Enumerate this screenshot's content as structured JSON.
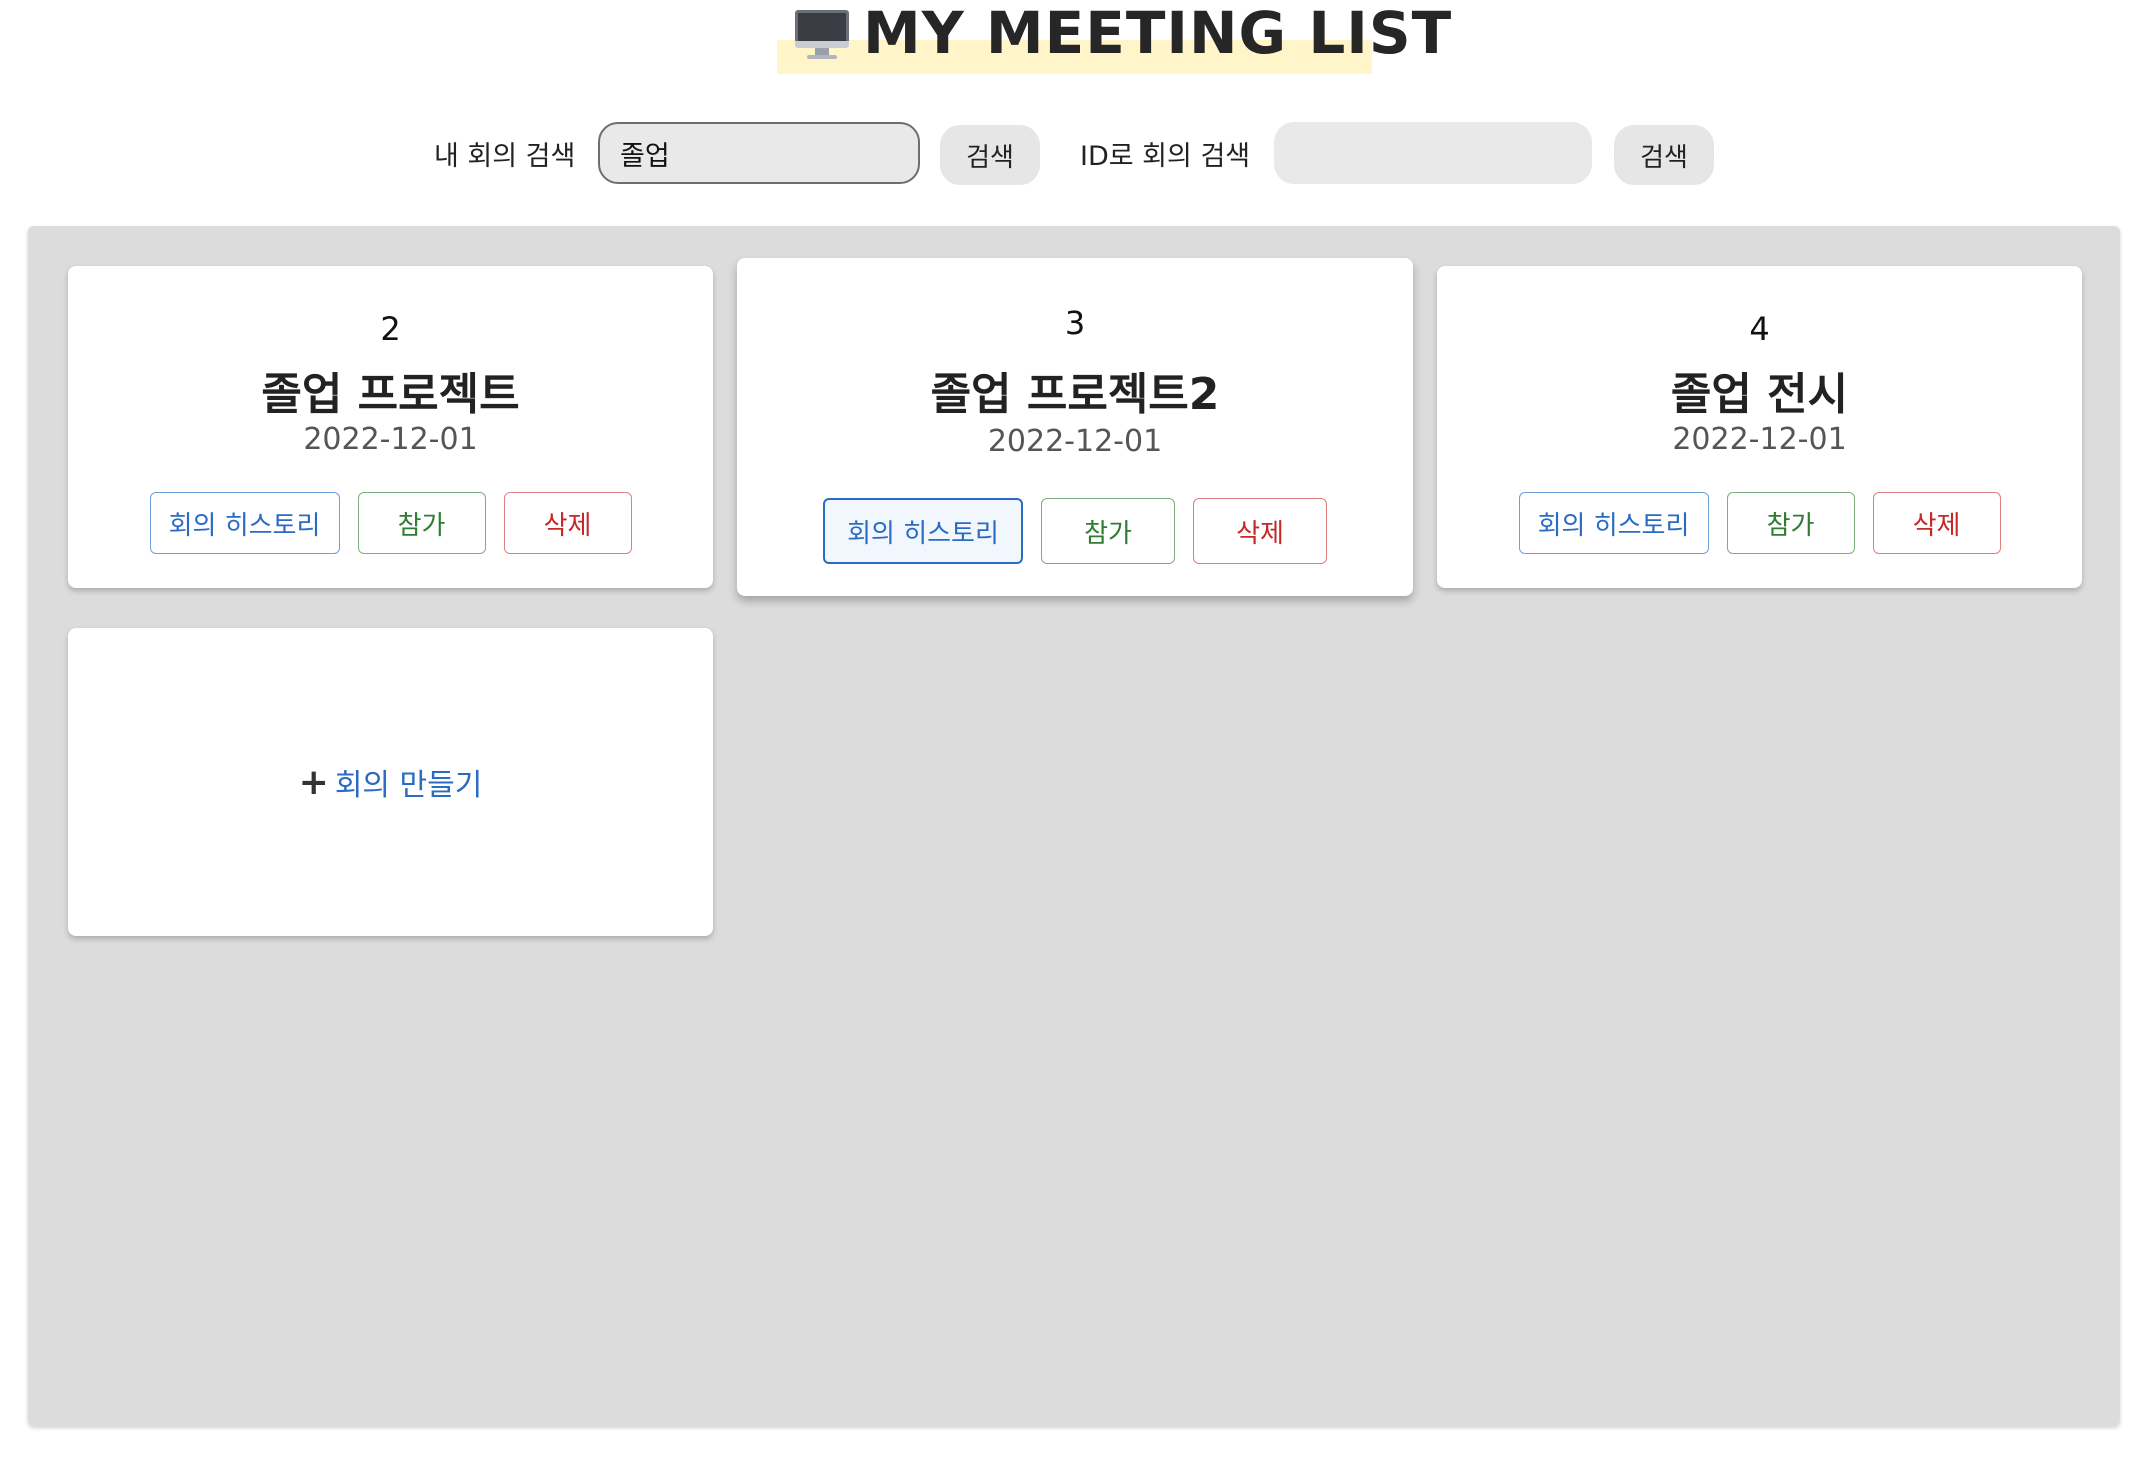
{
  "header": {
    "title": "MY MEETING LIST",
    "icon": "desktop-computer-icon"
  },
  "search": {
    "my_label": "내 회의 검색",
    "my_value": "졸업",
    "my_button": "검색",
    "id_label": "ID로 회의 검색",
    "id_value": "",
    "id_button": "검색"
  },
  "meetings": [
    {
      "id": "2",
      "name": "졸업 프로젝트",
      "date": "2022-12-01",
      "history_label": "회의 히스토리",
      "join_label": "참가",
      "delete_label": "삭제"
    },
    {
      "id": "3",
      "name": "졸업 프로젝트2",
      "date": "2022-12-01",
      "history_label": "회의 히스토리",
      "join_label": "참가",
      "delete_label": "삭제"
    },
    {
      "id": "4",
      "name": "졸업 전시",
      "date": "2022-12-01",
      "history_label": "회의 히스토리",
      "join_label": "참가",
      "delete_label": "삭제"
    }
  ],
  "create": {
    "plus": "+",
    "label": "회의 만들기"
  },
  "colors": {
    "board_bg": "#dcdcdc",
    "title_highlight": "#fff5c8",
    "history": "#2a6cc4",
    "join": "#2e7d32",
    "delete": "#c62828"
  }
}
